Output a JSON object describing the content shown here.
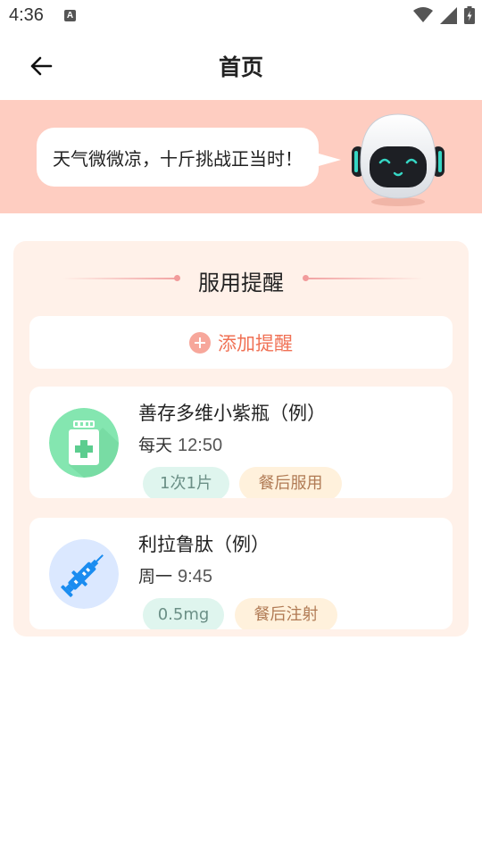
{
  "status_bar": {
    "time": "4:36",
    "notification_badge": "A",
    "icons": [
      "wifi-icon",
      "signal-icon",
      "battery-icon"
    ]
  },
  "app_bar": {
    "title": "首页",
    "back_icon": "arrow-left-icon"
  },
  "banner": {
    "message": "天气微微凉，十斤挑战正当时！",
    "mascot": "robot-mascot"
  },
  "reminders": {
    "section_title": "服用提醒",
    "add_button_label": "添加提醒",
    "items": [
      {
        "name": "善存多维小紫瓶（例）",
        "frequency": "每天",
        "time": "12:50",
        "dose": "1次1片",
        "timing": "餐后服用",
        "icon": "medicine-bottle-icon"
      },
      {
        "name": "利拉鲁肽（例）",
        "frequency": "周一",
        "time": "9:45",
        "dose": "0.5mg",
        "timing": "餐后注射",
        "icon": "syringe-icon"
      }
    ]
  },
  "colors": {
    "banner_bg": "#fecdc1",
    "panel_bg": "#fff1e9",
    "accent": "#f07155",
    "dose_tag_bg": "#dff5ee",
    "timing_tag_bg": "#fff1dc"
  }
}
